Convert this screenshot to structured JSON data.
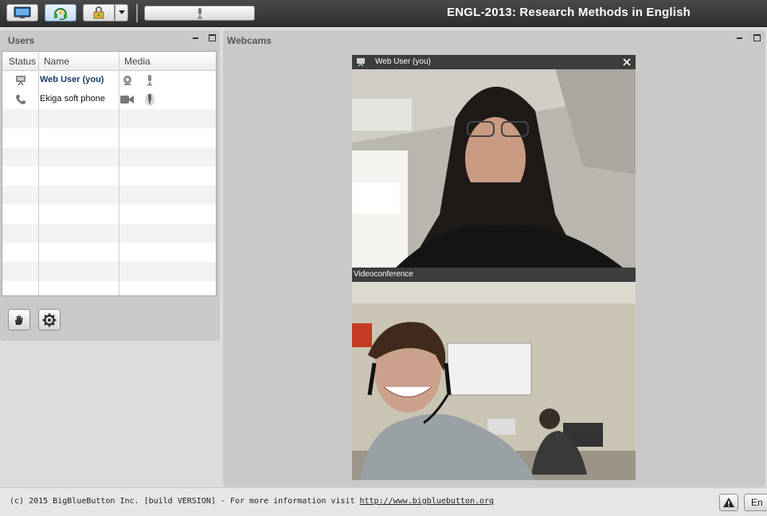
{
  "app": {
    "title": "ENGL-2013: Research Methods in English"
  },
  "users_panel": {
    "title": "Users",
    "columns": [
      "Status",
      "Name",
      "Media"
    ],
    "rows": [
      {
        "name": "Web User (you)"
      },
      {
        "name": "Ekiga soft phone"
      }
    ]
  },
  "webcams_panel": {
    "title": "Webcams",
    "cams": [
      {
        "label": "Web User (you)"
      },
      {
        "label": "Videoconference"
      }
    ]
  },
  "footer": {
    "text_prefix": "(c) 2015 BigBlueButton Inc. [build VERSION] - For more information visit ",
    "link": "http://www.bigbluebutton.org",
    "lang_button": "En"
  },
  "colors": {
    "toolbar": "#333333",
    "panel": "#c9c9c9",
    "you": "#1a3a6a"
  }
}
